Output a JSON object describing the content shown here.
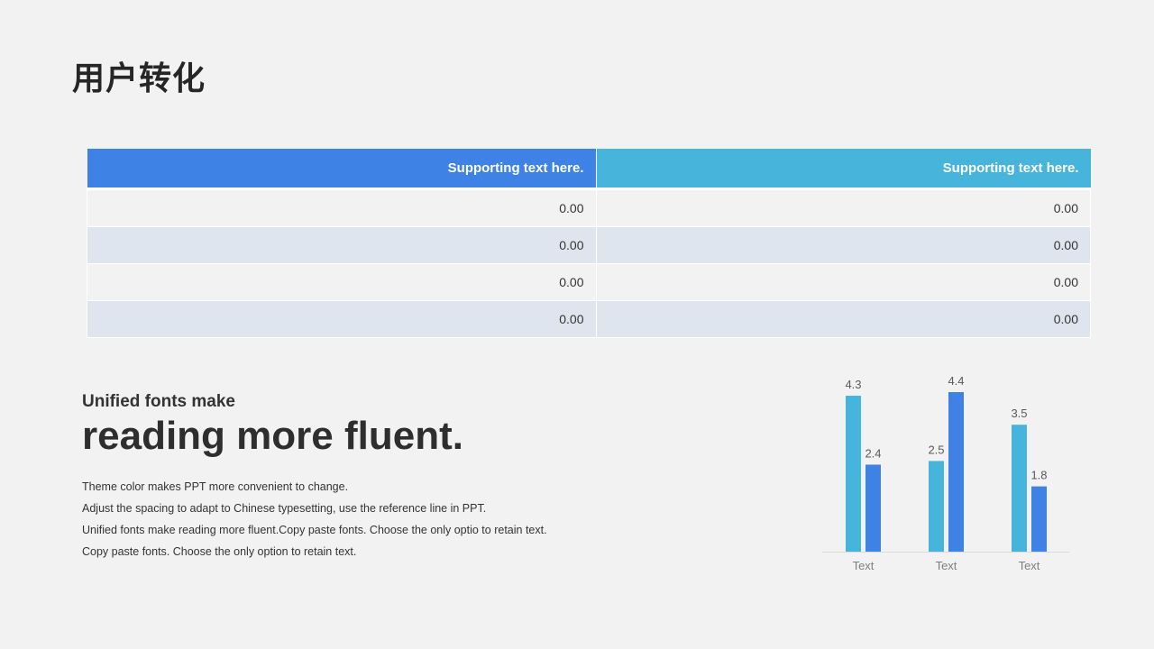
{
  "title": "用户转化",
  "table": {
    "headers": [
      "Supporting text here.",
      "Supporting text here."
    ],
    "rows": [
      [
        "0.00",
        "0.00"
      ],
      [
        "0.00",
        "0.00"
      ],
      [
        "0.00",
        "0.00"
      ],
      [
        "0.00",
        "0.00"
      ]
    ],
    "header_colors": [
      "#3e82e5",
      "#47b4dc"
    ]
  },
  "text_block": {
    "subheading": "Unified fonts make",
    "headline": "reading more fluent.",
    "lines": [
      "Theme color makes PPT more convenient to change.",
      "Adjust the spacing to adapt to Chinese typesetting, use the reference line in PPT.",
      "Unified fonts make reading more fluent.Copy paste fonts. Choose the only optio to retain text.",
      "Copy paste fonts. Choose the only option to retain text."
    ]
  },
  "chart_data": {
    "type": "bar",
    "categories": [
      "Text",
      "Text",
      "Text"
    ],
    "series": [
      {
        "values": [
          4.3,
          2.5,
          3.5
        ],
        "color": "#47b4dc"
      },
      {
        "values": [
          2.4,
          4.4,
          1.8
        ],
        "color": "#3e82e5"
      }
    ],
    "ylim": [
      0,
      4.4
    ],
    "grid": false,
    "legend": "none"
  }
}
